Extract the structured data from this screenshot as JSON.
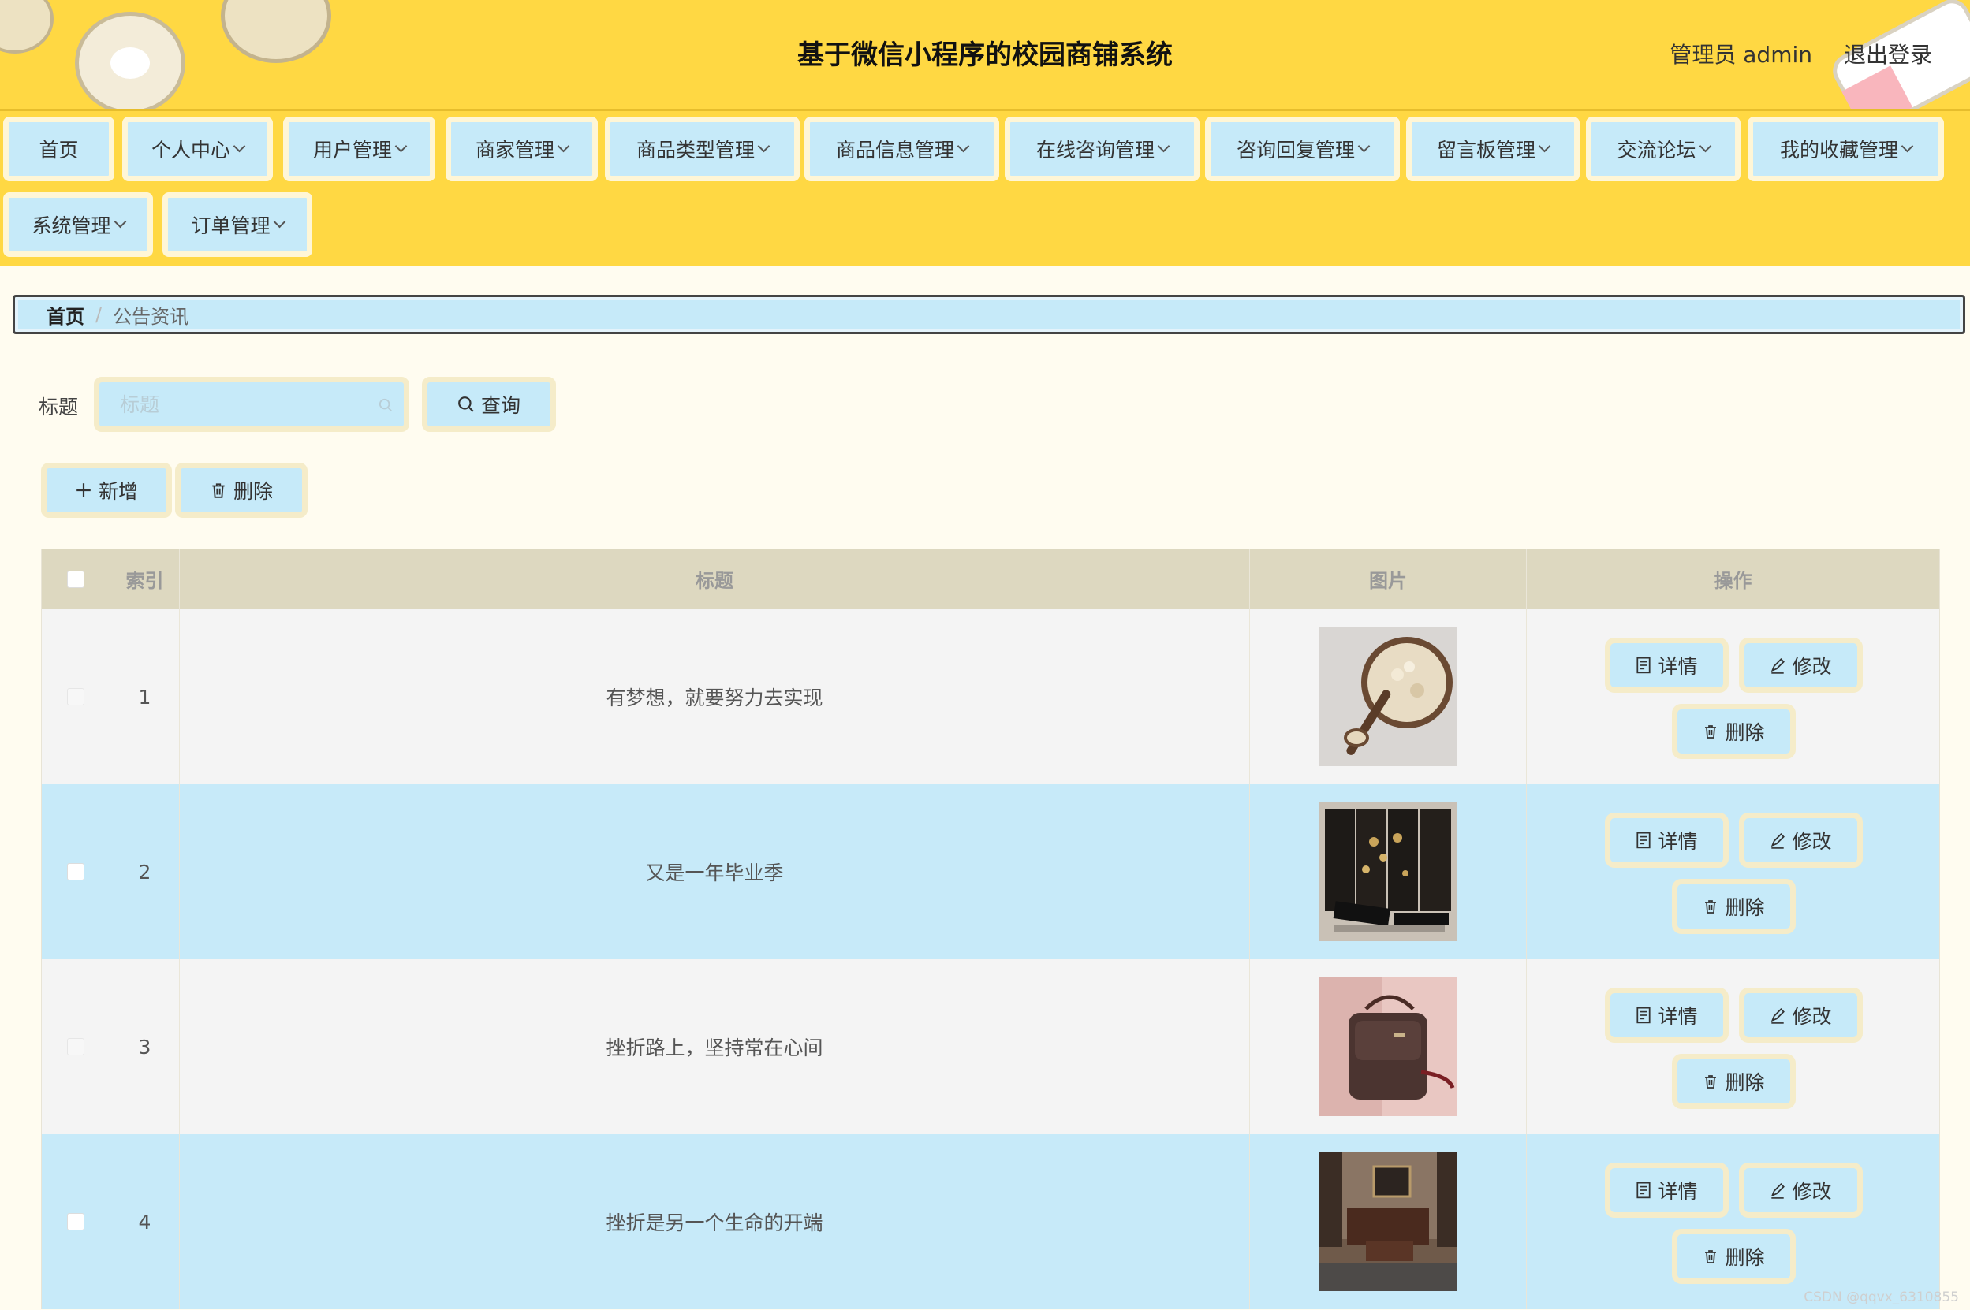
{
  "header": {
    "title": "基于微信小程序的校园商铺系统",
    "user_label": "管理员 admin",
    "logout_label": "退出登录"
  },
  "nav": {
    "items": [
      {
        "label": "首页",
        "dropdown": false
      },
      {
        "label": "个人中心",
        "dropdown": true
      },
      {
        "label": "用户管理",
        "dropdown": true
      },
      {
        "label": "商家管理",
        "dropdown": true
      },
      {
        "label": "商品类型管理",
        "dropdown": true
      },
      {
        "label": "商品信息管理",
        "dropdown": true
      },
      {
        "label": "在线咨询管理",
        "dropdown": true
      },
      {
        "label": "咨询回复管理",
        "dropdown": true
      },
      {
        "label": "留言板管理",
        "dropdown": true
      },
      {
        "label": "交流论坛",
        "dropdown": true
      },
      {
        "label": "我的收藏管理",
        "dropdown": true
      },
      {
        "label": "系统管理",
        "dropdown": true
      },
      {
        "label": "订单管理",
        "dropdown": true
      }
    ]
  },
  "breadcrumb": {
    "home": "首页",
    "separator": "/",
    "current": "公告资讯"
  },
  "search": {
    "label": "标题",
    "placeholder": "标题",
    "value": "",
    "query_button": "查询"
  },
  "toolbar": {
    "add_label": "新增",
    "delete_label": "删除"
  },
  "table": {
    "columns": [
      "索引",
      "标题",
      "图片",
      "操作"
    ],
    "rows": [
      {
        "index": "1",
        "title": "有梦想，就要努力去实现",
        "image": "oats-bowl"
      },
      {
        "index": "2",
        "title": "又是一年毕业季",
        "image": "lacquer-screen"
      },
      {
        "index": "3",
        "title": "挫折路上，坚持常在心间",
        "image": "handbag"
      },
      {
        "index": "4",
        "title": "挫折是另一个生命的开端",
        "image": "living-room"
      }
    ],
    "actions": {
      "detail": "详情",
      "edit": "修改",
      "delete": "删除"
    }
  },
  "colors": {
    "header_bg": "#ffd843",
    "button_bg": "#c6eaf9",
    "button_border": "#f5ecc9",
    "page_bg": "#fffcf0",
    "table_header_bg": "#ddd8c0"
  },
  "watermark": "CSDN @qqvx_6310855"
}
